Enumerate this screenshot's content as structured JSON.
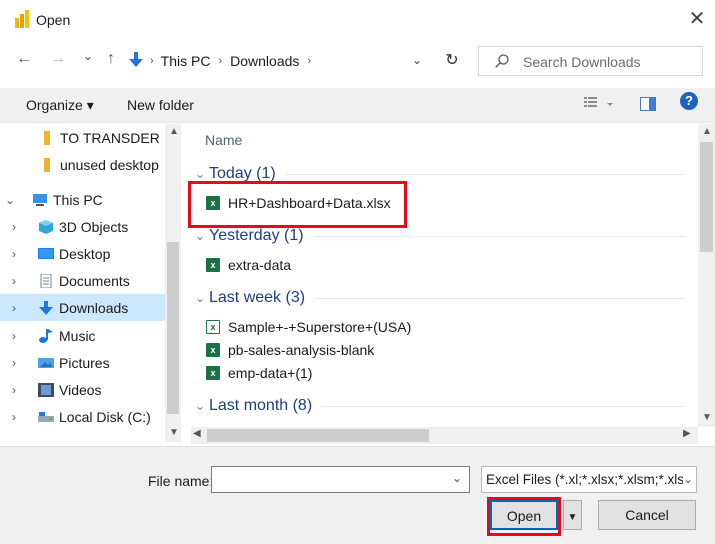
{
  "window": {
    "title": "Open",
    "close_glyph": "✕"
  },
  "nav": {
    "back": "←",
    "forward": "→",
    "recent": "⌄",
    "up": "↑",
    "refresh": "↻",
    "breadcrumb": [
      "This PC",
      "Downloads"
    ],
    "search_placeholder": "Search Downloads"
  },
  "toolbar": {
    "organize": "Organize ▾",
    "new_folder": "New folder",
    "help": "?"
  },
  "sidebar": {
    "items": [
      {
        "label": "TO TRANSDER",
        "icon": "folder-icon"
      },
      {
        "label": "unused desktop",
        "icon": "folder-icon"
      },
      {
        "label": "This PC",
        "icon": "computer-icon"
      },
      {
        "label": "3D Objects",
        "icon": "3d-objects-icon"
      },
      {
        "label": "Desktop",
        "icon": "desktop-icon"
      },
      {
        "label": "Documents",
        "icon": "documents-icon"
      },
      {
        "label": "Downloads",
        "icon": "downloads-icon"
      },
      {
        "label": "Music",
        "icon": "music-icon"
      },
      {
        "label": "Pictures",
        "icon": "pictures-icon"
      },
      {
        "label": "Videos",
        "icon": "videos-icon"
      },
      {
        "label": "Local Disk (C:)",
        "icon": "disk-icon"
      }
    ]
  },
  "files": {
    "column_name": "Name",
    "groups": [
      {
        "label": "Today (1)",
        "items": [
          "HR+Dashboard+Data.xlsx"
        ]
      },
      {
        "label": "Yesterday (1)",
        "items": [
          "extra-data"
        ]
      },
      {
        "label": "Last week (3)",
        "items": [
          "Sample+-+Superstore+(USA)",
          "pb-sales-analysis-blank",
          "emp-data+(1)"
        ]
      },
      {
        "label": "Last month (8)",
        "items": []
      }
    ]
  },
  "bottom": {
    "file_name_label": "File name:",
    "file_name_value": "",
    "file_type": "Excel Files (*.xl;*.xlsx;*.xlsm;*.xlsb",
    "open_label": "Open",
    "cancel_label": "Cancel"
  },
  "colors": {
    "accent": "#0067c0",
    "highlight": "#e20d17",
    "selected": "#cce8ff",
    "group_text": "#1e3e82"
  }
}
